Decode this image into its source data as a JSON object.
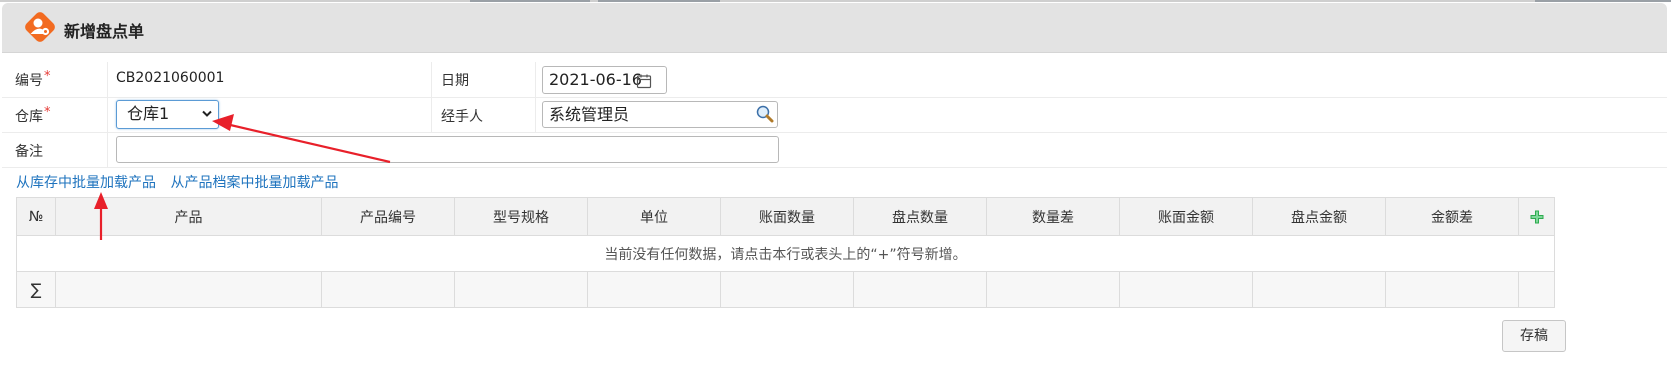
{
  "header": {
    "title": "新增盘点单",
    "icon": "user-settings-icon",
    "accent_color": "#f26b21"
  },
  "form": {
    "number_label": "编号",
    "number_value": "CB2021060001",
    "date_label": "日期",
    "date_value": "2021-06-16",
    "warehouse_label": "仓库",
    "warehouse_value": "仓库1",
    "handler_label": "经手人",
    "handler_value": "系统管理员",
    "remark_label": "备注",
    "remark_value": "",
    "required_mark": "*"
  },
  "links": {
    "load_from_stock": "从库存中批量加载产品",
    "load_from_catalog": "从产品档案中批量加载产品"
  },
  "table": {
    "columns": [
      "№",
      "产品",
      "产品编号",
      "型号规格",
      "单位",
      "账面数量",
      "盘点数量",
      "数量差",
      "账面金额",
      "盘点金额",
      "金额差"
    ],
    "empty_message": "当前没有任何数据，请点击本行或表头上的“+”符号新增。",
    "sum_symbol": "∑",
    "add_icon": "plus-icon",
    "add_icon_color": "#2eab4f"
  },
  "footer": {
    "save_draft": "存稿"
  },
  "annotation_color": "#e8202a"
}
